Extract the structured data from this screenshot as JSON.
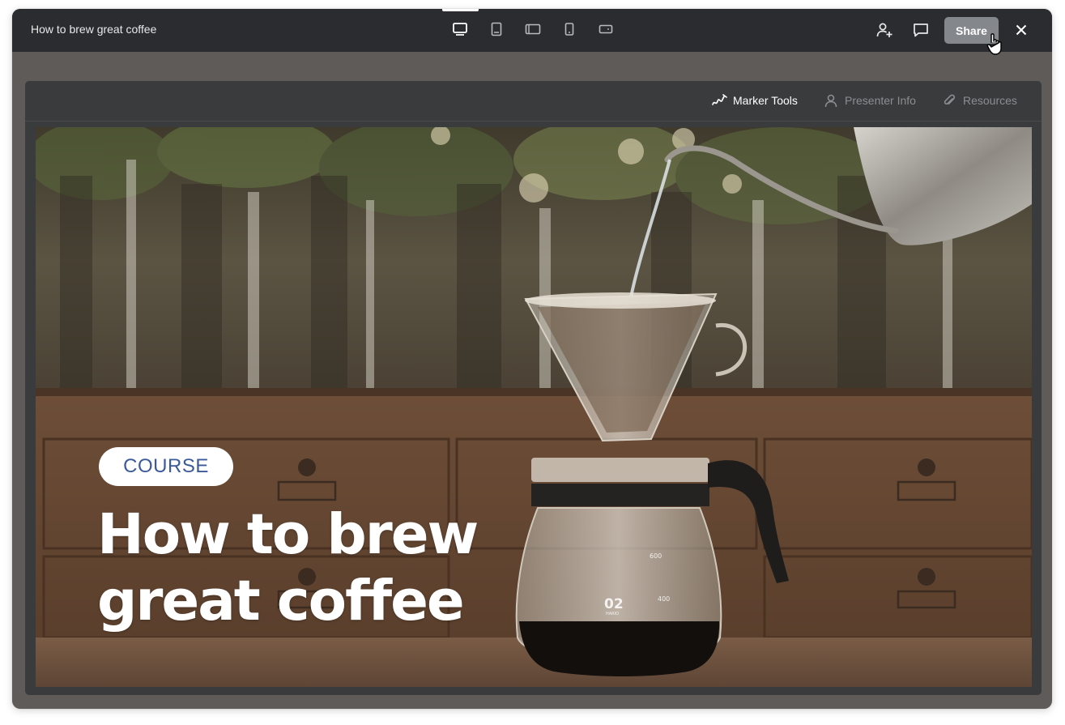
{
  "window": {
    "title": "How to brew great coffee"
  },
  "top_bar": {
    "device_views": [
      {
        "icon": "desktop-icon",
        "active": true
      },
      {
        "icon": "tablet-portrait-icon",
        "active": false
      },
      {
        "icon": "tablet-landscape-icon",
        "active": false
      },
      {
        "icon": "phone-portrait-icon",
        "active": false
      },
      {
        "icon": "phone-landscape-icon",
        "active": false
      }
    ],
    "actions": [
      {
        "icon": "add-user-icon"
      },
      {
        "icon": "comment-icon"
      }
    ],
    "share_label": "Share",
    "close_icon": "close-icon"
  },
  "panel_toolbar": {
    "tools": [
      {
        "label": "Marker Tools",
        "icon": "marker-icon",
        "active": true
      },
      {
        "label": "Presenter Info",
        "icon": "person-icon",
        "active": false
      },
      {
        "label": "Resources",
        "icon": "paperclip-icon",
        "active": false
      }
    ]
  },
  "slide": {
    "tag": "COURSE",
    "title": "How to brew great coffee",
    "image_description_icon": "coffee-pour-over-photo",
    "carafe_marks": [
      "600",
      "400",
      "02",
      "HARIO"
    ]
  },
  "colors": {
    "topbar": "#2b2c2f",
    "window_bg": "#5e5b58",
    "panel": "#3a3b3d",
    "share_button": "#84878b",
    "tag_text": "#3a5a9a"
  }
}
